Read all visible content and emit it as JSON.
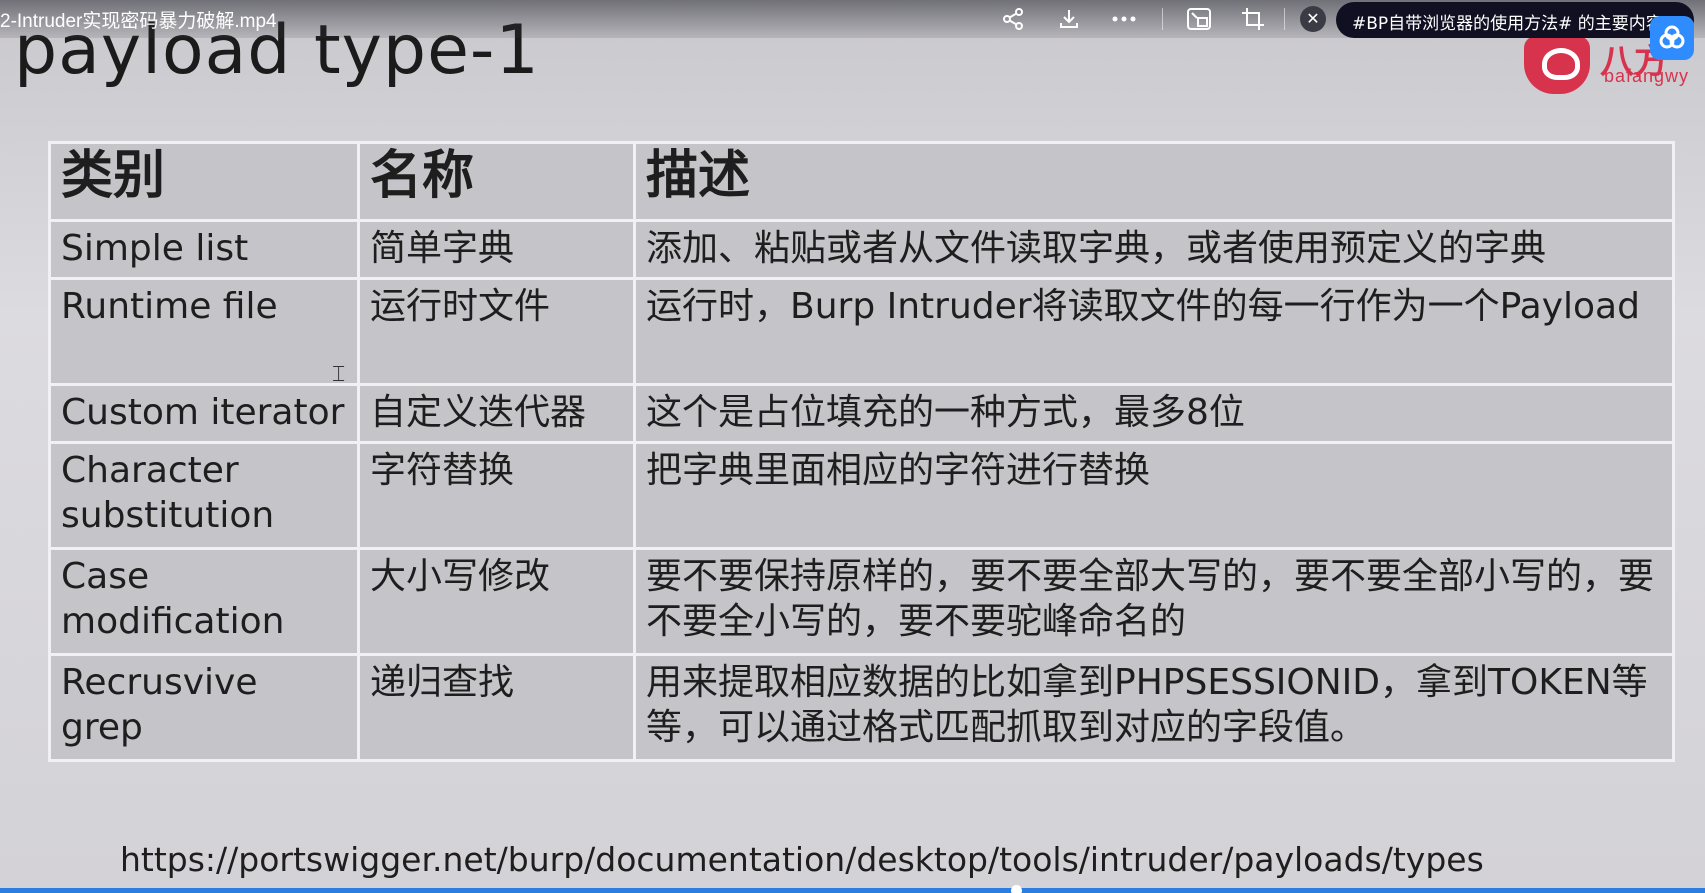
{
  "player": {
    "video_title": "2-Intruder实现密码暴力破解.mp4",
    "icons": [
      "share-icon",
      "download-icon",
      "more-icon",
      "picture-in-picture-icon",
      "crop-icon",
      "close-icon"
    ],
    "pill_text": "#BP自带浏览器的使用方法# 的主要内容",
    "progress": 0.596
  },
  "slide": {
    "title": "payload type-1",
    "logo_text": "bafangwy",
    "logo_glyph": "八方",
    "table": {
      "headers": [
        "类别",
        "名称",
        "描述"
      ],
      "rows": [
        {
          "category": "Simple list",
          "name": "简单字典",
          "description": "添加、粘贴或者从文件读取字典，或者使用预定义的字典"
        },
        {
          "category": "Runtime file",
          "name": "运行时文件",
          "description": "运行时，Burp Intruder将读取文件的每一行作为一个Payload"
        },
        {
          "category": "Custom iterator",
          "name": "自定义迭代器",
          "description": "这个是占位填充的一种方式，最多8位"
        },
        {
          "category": "Character substitution",
          "name": "字符替换",
          "description": "把字典里面相应的字符进行替换"
        },
        {
          "category": "Case modification",
          "name": "大小写修改",
          "description": "要不要保持原样的，要不要全部大写的，要不要全部小写的，要不要全小写的，要不要驼峰命名的"
        },
        {
          "category": "Recrusvive grep",
          "name": "递归查找",
          "description": "用来提取相应数据的比如拿到PHPSESSIONID，拿到TOKEN等等，可以通过格式匹配抓取到对应的字段值。"
        }
      ]
    },
    "url": "https://portswigger.net/burp/documentation/desktop/tools/intruder/payloads/types"
  }
}
